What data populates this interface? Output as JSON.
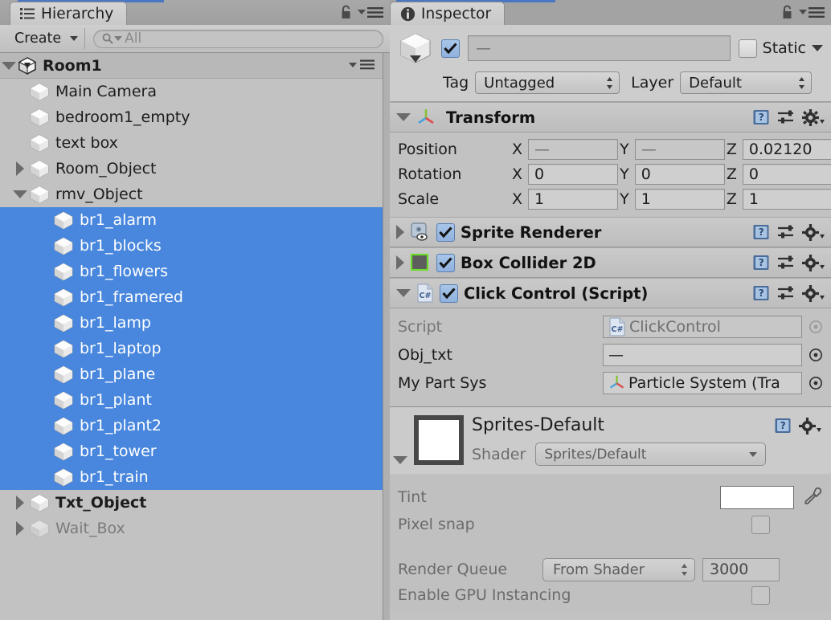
{
  "hierarchy": {
    "tab_label": "Hierarchy",
    "tab_icon": "hierarchy-list-icon",
    "create_label": "Create",
    "search_placeholder": "All",
    "root": {
      "label": "Room1",
      "icon": "unity-scene-icon",
      "expanded": true
    },
    "items": [
      {
        "label": "Main Camera",
        "depth": 1,
        "twisty": "none",
        "selected": false,
        "inactive": false,
        "bold": false
      },
      {
        "label": "bedroom1_empty",
        "depth": 1,
        "twisty": "none",
        "selected": false,
        "inactive": false,
        "bold": false
      },
      {
        "label": "text box",
        "depth": 1,
        "twisty": "none",
        "selected": false,
        "inactive": false,
        "bold": false
      },
      {
        "label": "Room_Object",
        "depth": 1,
        "twisty": "right",
        "selected": false,
        "inactive": false,
        "bold": false
      },
      {
        "label": "rmv_Object",
        "depth": 1,
        "twisty": "down",
        "selected": false,
        "inactive": false,
        "bold": false
      },
      {
        "label": "br1_alarm",
        "depth": 2,
        "twisty": "none",
        "selected": true,
        "inactive": false,
        "bold": false
      },
      {
        "label": "br1_blocks",
        "depth": 2,
        "twisty": "none",
        "selected": true,
        "inactive": false,
        "bold": false
      },
      {
        "label": "br1_flowers",
        "depth": 2,
        "twisty": "none",
        "selected": true,
        "inactive": false,
        "bold": false
      },
      {
        "label": "br1_framered",
        "depth": 2,
        "twisty": "none",
        "selected": true,
        "inactive": false,
        "bold": false
      },
      {
        "label": "br1_lamp",
        "depth": 2,
        "twisty": "none",
        "selected": true,
        "inactive": false,
        "bold": false
      },
      {
        "label": "br1_laptop",
        "depth": 2,
        "twisty": "none",
        "selected": true,
        "inactive": false,
        "bold": false
      },
      {
        "label": "br1_plane",
        "depth": 2,
        "twisty": "none",
        "selected": true,
        "inactive": false,
        "bold": false
      },
      {
        "label": "br1_plant",
        "depth": 2,
        "twisty": "none",
        "selected": true,
        "inactive": false,
        "bold": false
      },
      {
        "label": "br1_plant2",
        "depth": 2,
        "twisty": "none",
        "selected": true,
        "inactive": false,
        "bold": false
      },
      {
        "label": "br1_tower",
        "depth": 2,
        "twisty": "none",
        "selected": true,
        "inactive": false,
        "bold": false
      },
      {
        "label": "br1_train",
        "depth": 2,
        "twisty": "none",
        "selected": true,
        "inactive": false,
        "bold": false
      },
      {
        "label": "Txt_Object",
        "depth": 1,
        "twisty": "right",
        "selected": false,
        "inactive": false,
        "bold": true
      },
      {
        "label": "Wait_Box",
        "depth": 1,
        "twisty": "right",
        "selected": false,
        "inactive": true,
        "bold": false
      }
    ]
  },
  "inspector": {
    "tab_label": "Inspector",
    "tab_icon": "info-circle-icon",
    "object_name": "—",
    "object_enabled": true,
    "static_label": "Static",
    "static_checked": false,
    "tag_label": "Tag",
    "tag_value": "Untagged",
    "layer_label": "Layer",
    "layer_value": "Default",
    "transform": {
      "title": "Transform",
      "expanded": true,
      "rows": [
        {
          "label": "Position",
          "x": "—",
          "y": "—",
          "z": "0.02120",
          "x_empty": true,
          "y_empty": true,
          "z_empty": false
        },
        {
          "label": "Rotation",
          "x": "0",
          "y": "0",
          "z": "0",
          "x_empty": false,
          "y_empty": false,
          "z_empty": false
        },
        {
          "label": "Scale",
          "x": "1",
          "y": "1",
          "z": "1",
          "x_empty": false,
          "y_empty": false,
          "z_empty": false
        }
      ]
    },
    "components": [
      {
        "title": "Sprite Renderer",
        "icon": "sprite-renderer-icon",
        "enabled": true,
        "expanded": false
      },
      {
        "title": "Box Collider 2D",
        "icon": "box-collider-2d-icon",
        "enabled": true,
        "expanded": false
      },
      {
        "title": "Click Control (Script)",
        "icon": "csharp-script-icon",
        "enabled": true,
        "expanded": true
      }
    ],
    "script_fields": [
      {
        "label": "Script",
        "value": "ClickControl",
        "icon": "csharp-script-icon",
        "dim": true,
        "dot": "dim"
      },
      {
        "label": "Obj_txt",
        "value": "—",
        "icon": "none",
        "dim": false,
        "dot": "solid"
      },
      {
        "label": "My Part Sys",
        "value": "Particle System (Tra",
        "icon": "transform-axis-icon",
        "dim": false,
        "dot": "solid"
      }
    ],
    "material": {
      "name": "Sprites-Default",
      "shader_label": "Shader",
      "shader_value": "Sprites/Default",
      "tint_label": "Tint",
      "tint_color": "#ffffff",
      "pixel_snap_label": "Pixel snap",
      "pixel_snap_checked": false,
      "render_queue_label": "Render Queue",
      "render_queue_mode": "From Shader",
      "render_queue_value": "3000",
      "gpu_instancing_label": "Enable GPU Instancing",
      "gpu_instancing_checked": false
    }
  },
  "colors": {
    "selection_blue": "#4887dd",
    "tab_accent": "#4a77c4",
    "panel_bg": "#c2c2c2",
    "chrome_bg": "#a3a3a3"
  }
}
